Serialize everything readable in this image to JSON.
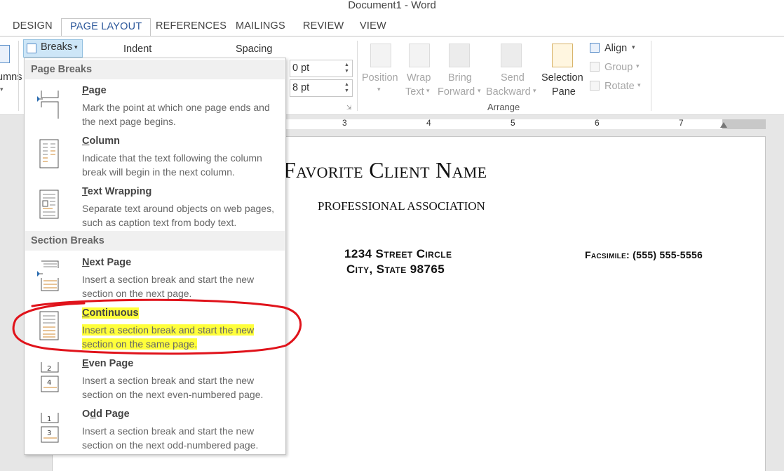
{
  "window": {
    "title": "Document1 - Word"
  },
  "tabs": [
    "DESIGN",
    "PAGE LAYOUT",
    "REFERENCES",
    "MAILINGS",
    "REVIEW",
    "VIEW"
  ],
  "ribbon": {
    "columns_partial": "umns",
    "breaks_label": "Breaks",
    "indent_label": "Indent",
    "spacing_label": "Spacing",
    "spacing_before": "0 pt",
    "spacing_after": "8 pt",
    "arrange": {
      "group_label": "Arrange",
      "position": [
        "Position"
      ],
      "wrap_text": [
        "Wrap",
        "Text"
      ],
      "bring_forward": [
        "Bring",
        "Forward"
      ],
      "send_backward": [
        "Send",
        "Backward"
      ],
      "selection_pane": [
        "Selection",
        "Pane"
      ],
      "align": "Align",
      "group": "Group",
      "rotate": "Rotate"
    }
  },
  "ruler": {
    "numbers": [
      "3",
      "4",
      "5",
      "6",
      "7"
    ]
  },
  "breaks_menu": {
    "page_breaks_header": "Page Breaks",
    "section_breaks_header": "Section Breaks",
    "page_items": [
      {
        "title": "Page",
        "desc": "Mark the point at which one page ends and the next page begins."
      },
      {
        "title": "Column",
        "desc": "Indicate that the text following the column break will begin in the next column."
      },
      {
        "title": "Text Wrapping",
        "desc": "Separate text around objects on web pages, such as caption text from body text."
      }
    ],
    "section_items": [
      {
        "title": "Next Page",
        "desc": "Insert a section break and start the new section on the next page."
      },
      {
        "title": "Continuous",
        "desc_line1": "Insert a section break and start the new",
        "desc_line2": "section on the same page."
      },
      {
        "title": "Even Page",
        "desc": "Insert a section break and start the new section on the next even-numbered page."
      },
      {
        "title": "Odd Page",
        "desc": "Insert a section break and start the new section on the next odd-numbered page."
      }
    ]
  },
  "document": {
    "client_name": "Favorite Client Name",
    "association": "PROFESSIONAL ASSOCIATION",
    "address_line1": "1234 Street Circle",
    "address_line2": "City, State  98765",
    "facsimile": "Facsimile: (555) 555-5556"
  },
  "colors": {
    "accent": "#2b579a",
    "highlight": "#ffff3a",
    "annotation": "#e0131b"
  }
}
